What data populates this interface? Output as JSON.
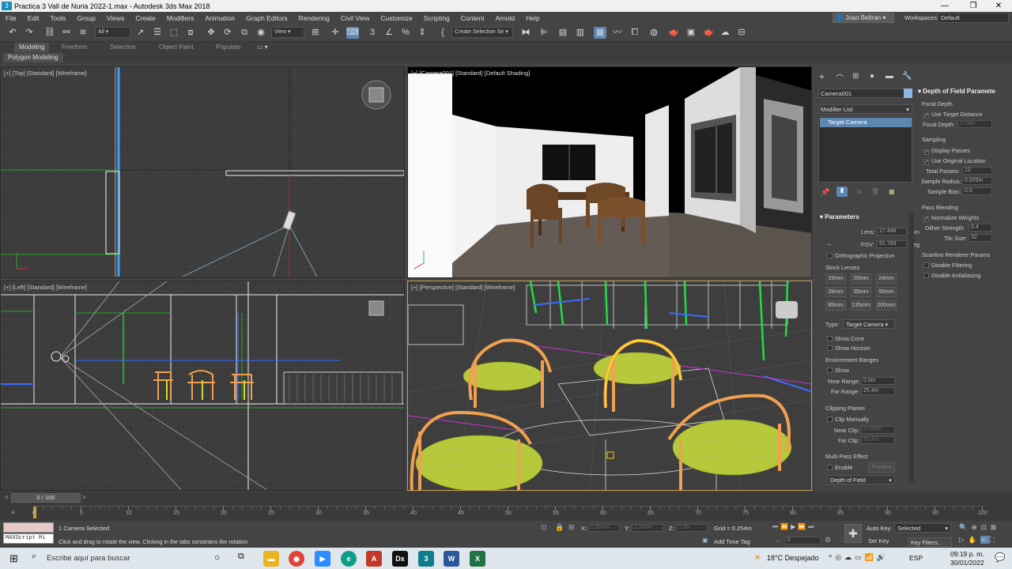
{
  "window": {
    "title": "Practica 3 Vall de Nuria 2022-1.max - Autodesk 3ds Max 2018"
  },
  "menu": [
    "File",
    "Edit",
    "Tools",
    "Group",
    "Views",
    "Create",
    "Modifiers",
    "Animation",
    "Graph Editors",
    "Rendering",
    "Civil View",
    "Customize",
    "Scripting",
    "Content",
    "Arnold",
    "Help"
  ],
  "user": {
    "name": "Joao Beltran",
    "workspaces_label": "Workspaces:",
    "workspace": "Default"
  },
  "toolbar": {
    "filter": "All",
    "ref_coord": "View",
    "selection_set": "Create Selection Se"
  },
  "ribbon": {
    "tabs": [
      "Modeling",
      "Freeform",
      "Selection",
      "Object Paint",
      "Populate"
    ],
    "sub": "Polygon Modeling"
  },
  "viewports": {
    "top": "[+] [Top] [Standard] [Wireframe]",
    "camera": "[+] [Camera001] [Standard] [Default Shading]",
    "left": "[+] [Left] [Standard] [Wireframe]",
    "perspective": "[+] [Perspective] [Standard] [Wireframe]"
  },
  "command_panel": {
    "object_name": "Camera001",
    "modifier_list": "Modifier List",
    "stack_item": "Target Camera",
    "parameters": {
      "title": "Parameters",
      "lens_label": "Lens:",
      "lens": "17.448",
      "lens_unit": "mm",
      "fov_label": "FOV:",
      "fov": "91.783",
      "fov_unit": "deg.",
      "ortho": "Orthographic Projection",
      "stock_label": "Stock Lenses",
      "stock": [
        "15mm",
        "20mm",
        "24mm",
        "28mm",
        "35mm",
        "50mm",
        "85mm",
        "135mm",
        "200mm"
      ],
      "type_label": "Type:",
      "type": "Target Camera",
      "show_cone": "Show Cone",
      "show_horizon": "Show Horizon",
      "env_ranges": "Environment Ranges",
      "show": "Show",
      "near_range_label": "Near Range:",
      "near_range": "0.0m",
      "far_range_label": "Far Range:",
      "far_range": "25.4m",
      "clipping": "Clipping Planes",
      "clip_manually": "Clip Manually",
      "near_clip_label": "Near Clip:",
      "near_clip": "0.029m",
      "far_clip_label": "Far Clip:",
      "far_clip": "25.4m",
      "multipass": "Multi-Pass Effect",
      "enable": "Enable",
      "preview": "Preview",
      "effect": "Depth of Field"
    },
    "dof": {
      "title": "Depth of Field Paramete",
      "focal_depth": "Focal Depth",
      "use_target": "Use Target Distance",
      "focal_depth_label": "Focal Depth:",
      "focal_depth_val": "2.54m",
      "sampling": "Sampling",
      "display_passes": "Display Passes",
      "use_original": "Use Original Location",
      "total_passes_label": "Total Passes:",
      "total_passes": "12",
      "sample_radius_label": "Sample Radius:",
      "sample_radius": "0.025m",
      "sample_bias_label": "Sample Bias:",
      "sample_bias": "0.5",
      "pass_blending": "Pass Blending",
      "normalize": "Normalize Weights",
      "dither_label": "Dither Strength:",
      "dither": "0.4",
      "tile_label": "Tile Size:",
      "tile": "32",
      "scanline": "Scanline Renderer Params",
      "disable_filtering": "Disable Filtering",
      "disable_aa": "Disable Antialiasing"
    }
  },
  "timeline": {
    "frame": "0 / 100",
    "ticks": [
      "0",
      "5",
      "10",
      "15",
      "20",
      "25",
      "30",
      "35",
      "40",
      "45",
      "50",
      "55",
      "60",
      "65",
      "70",
      "75",
      "80",
      "85",
      "90",
      "95",
      "100"
    ]
  },
  "status": {
    "maxscript": "MAXScript Mi",
    "selected": "1 Camera Selected",
    "prompt": "Click and drag to rotate the view.  Clicking in the tabs constrains the rotation",
    "x_label": "X:",
    "x": "5.664m",
    "y_label": "Y:",
    "y": "5.246m",
    "z_label": "Z:",
    "z": "0.0m",
    "grid": "Grid = 0.254m",
    "add_time_tag": "Add Time Tag",
    "autokey": "Auto Key",
    "setkey": "Set Key",
    "selected_dd": "Selected",
    "key_filters": "Key Filters...",
    "frame_field": "0"
  },
  "taskbar": {
    "search": "Escribe aquí para buscar",
    "weather": "18°C  Despejado",
    "lang": "ESP",
    "time": "09:19 p. m.",
    "date": "30/01/2022"
  }
}
